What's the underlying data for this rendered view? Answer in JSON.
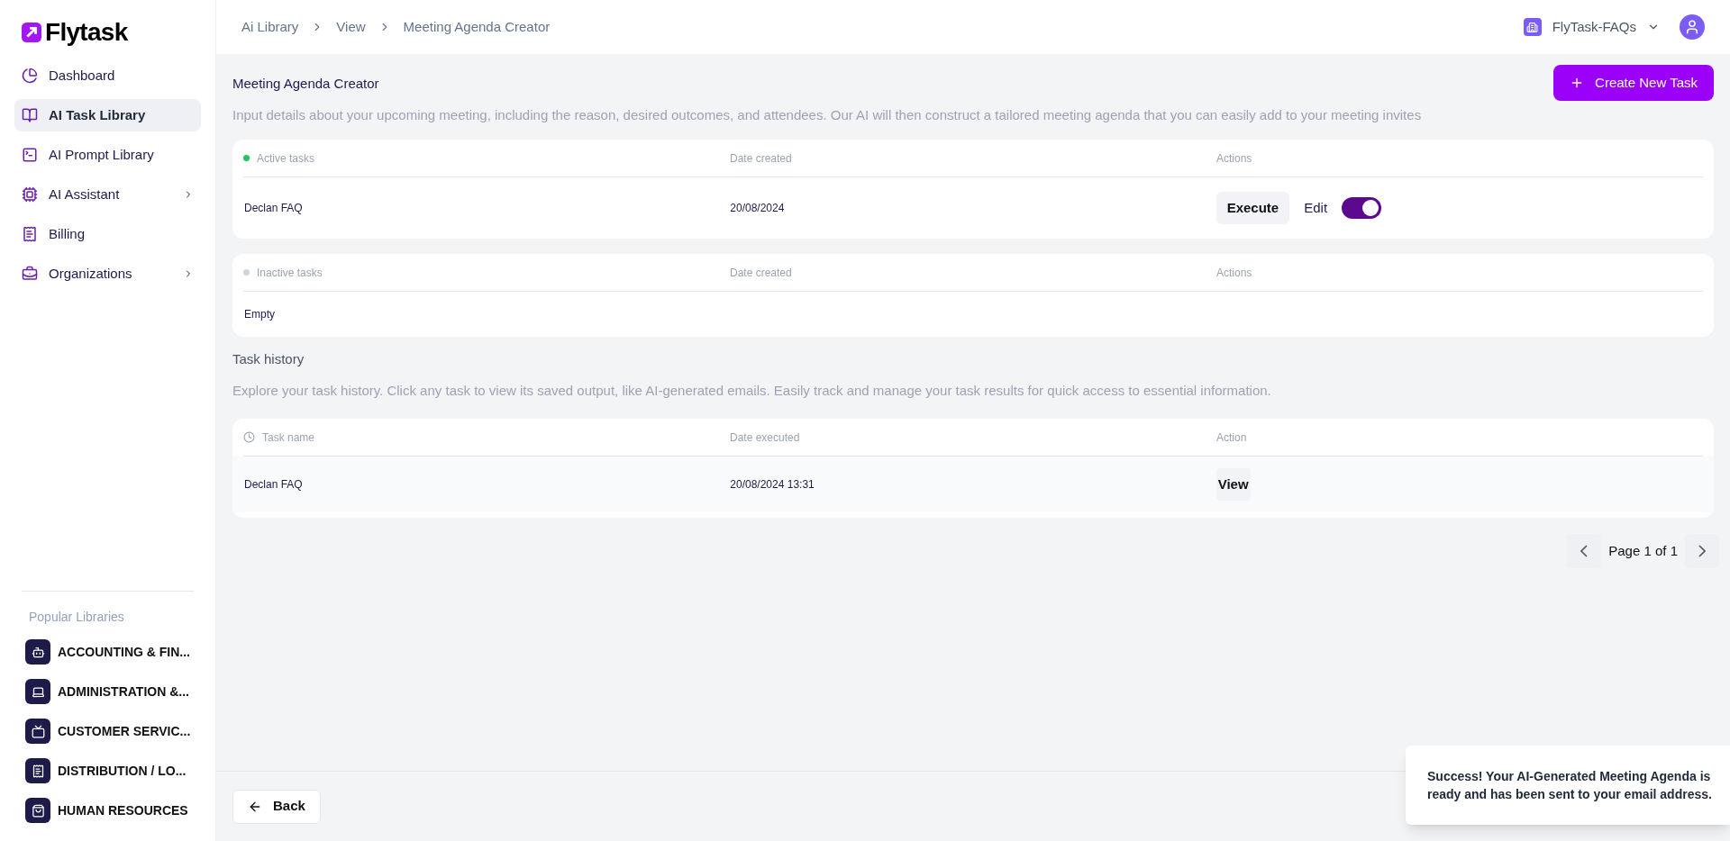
{
  "sidebar": {
    "logo": "Flytask",
    "items": [
      {
        "label": "Dashboard",
        "kind": "dashboard",
        "selected": false,
        "has_submenu": false
      },
      {
        "label": "AI Task Library",
        "kind": "book",
        "selected": true,
        "has_submenu": false
      },
      {
        "label": "AI Prompt Library",
        "kind": "terminal",
        "selected": false,
        "has_submenu": false
      },
      {
        "label": "AI Assistant",
        "kind": "chip",
        "selected": false,
        "has_submenu": true
      },
      {
        "label": "Billing",
        "kind": "receipt",
        "selected": false,
        "has_submenu": false
      },
      {
        "label": "Organizations",
        "kind": "briefcase",
        "selected": false,
        "has_submenu": true
      }
    ],
    "section_title": "Popular Libraries",
    "libraries": [
      {
        "label": "ACCOUNTING & FIN...",
        "kind": "bot"
      },
      {
        "label": "ADMINISTRATION &...",
        "kind": "laptop"
      },
      {
        "label": "CUSTOMER SERVIC...",
        "kind": "tv"
      },
      {
        "label": "DISTRIBUTION / LO...",
        "kind": "receipt"
      },
      {
        "label": "HUMAN RESOURCES",
        "kind": "bag"
      }
    ]
  },
  "breadcrumb": [
    "Ai Library",
    "View",
    "Meeting Agenda Creator"
  ],
  "workspace": {
    "name": "FlyTask-FAQs"
  },
  "page": {
    "title": "Meeting Agenda Creator",
    "description": "Input details about your upcoming meeting, including the reason, desired outcomes, and attendees. Our AI will then construct a tailored meeting agenda that you can easily add to your meeting invites",
    "create_button": "Create New Task"
  },
  "active_tasks": {
    "color": "#22c55e",
    "columns": [
      "Active tasks",
      "Date created",
      "Actions"
    ],
    "rows": [
      {
        "name": "Declan FAQ",
        "date": "20/08/2024",
        "execute": "Execute",
        "edit_label": "Edit",
        "on": true
      }
    ]
  },
  "inactive_tasks": {
    "color": "#d1d5db",
    "columns": [
      "Inactive tasks",
      "Date created",
      "Actions"
    ],
    "empty": "Empty"
  },
  "history": {
    "title": "Task history",
    "description": "Explore your task history. Click any task to view its saved output, like AI-generated emails. Easily track and manage your task results for quick access to essential information.",
    "columns": [
      "Task name",
      "Date executed",
      "Action"
    ],
    "rows": [
      {
        "name": "Declan FAQ",
        "date": "20/08/2024 13:31",
        "action": "View"
      }
    ]
  },
  "pagination": {
    "label": "Page 1 of 1"
  },
  "back_button": "Back",
  "toast": {
    "message": "Success! Your AI-Generated Meeting Agenda is ready and has been sent to your email address."
  }
}
